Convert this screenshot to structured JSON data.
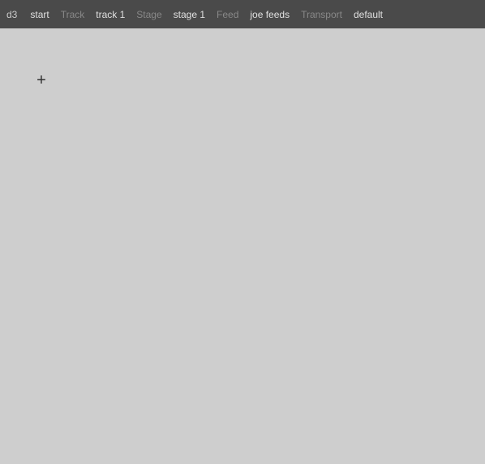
{
  "toolbar": {
    "app_id": "d3",
    "start_label": "start",
    "track_label": "Track",
    "track_value": "track 1",
    "stage_label": "Stage",
    "stage_value": "stage 1",
    "feed_label": "Feed",
    "feed_value": "joe feeds",
    "transport_label": "Transport",
    "transport_value": "default"
  },
  "canvas": {
    "cursor_icon": "crosshair"
  }
}
